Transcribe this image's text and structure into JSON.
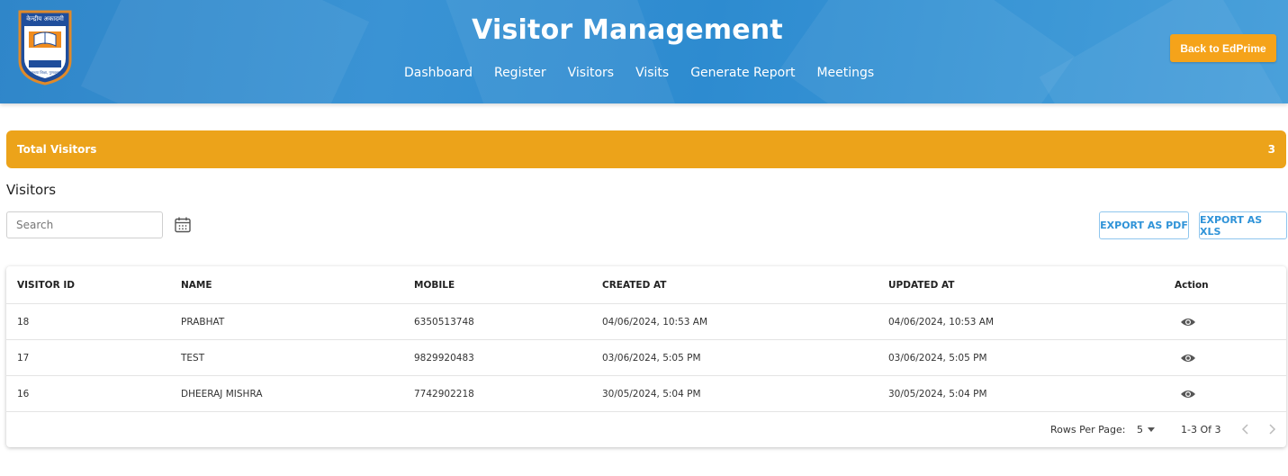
{
  "header": {
    "title": "Visitor Management",
    "nav": [
      "Dashboard",
      "Register",
      "Visitors",
      "Visits",
      "Generate Report",
      "Meetings"
    ],
    "back_button": "Back to EdPrime",
    "logo_text_top": "केन्द्रीय अकादमी",
    "logo_text_bottom": "सन्ध्या शिक्षा, गुणवत्ता"
  },
  "summary": {
    "label": "Total Visitors",
    "count": "3"
  },
  "section_title": "Visitors",
  "search": {
    "placeholder": "Search",
    "value": ""
  },
  "actions": {
    "export_pdf": "EXPORT AS PDF",
    "export_xls": "EXPORT AS XLS"
  },
  "table": {
    "columns": [
      "VISITOR ID",
      "NAME",
      "MOBILE",
      "CREATED AT",
      "UPDATED AT",
      "Action"
    ],
    "rows": [
      [
        "18",
        "PRABHAT",
        "6350513748",
        "04/06/2024, 10:53 AM",
        "04/06/2024, 10:53 AM"
      ],
      [
        "17",
        "TEST",
        "9829920483",
        "03/06/2024, 5:05 PM",
        "03/06/2024, 5:05 PM"
      ],
      [
        "16",
        "DHEERAJ MISHRA",
        "7742902218",
        "30/05/2024, 5:04 PM",
        "30/05/2024, 5:04 PM"
      ]
    ],
    "action_icon": "eye-icon"
  },
  "pagination": {
    "rows_per_page_label": "Rows Per Page:",
    "rows_per_page_value": "5",
    "range": "1-3 Of 3"
  },
  "colors": {
    "header_blue": "#2f86c9",
    "accent_orange": "#eca31a",
    "button_orange": "#f5a31a",
    "link_blue": "#2f93d8"
  }
}
